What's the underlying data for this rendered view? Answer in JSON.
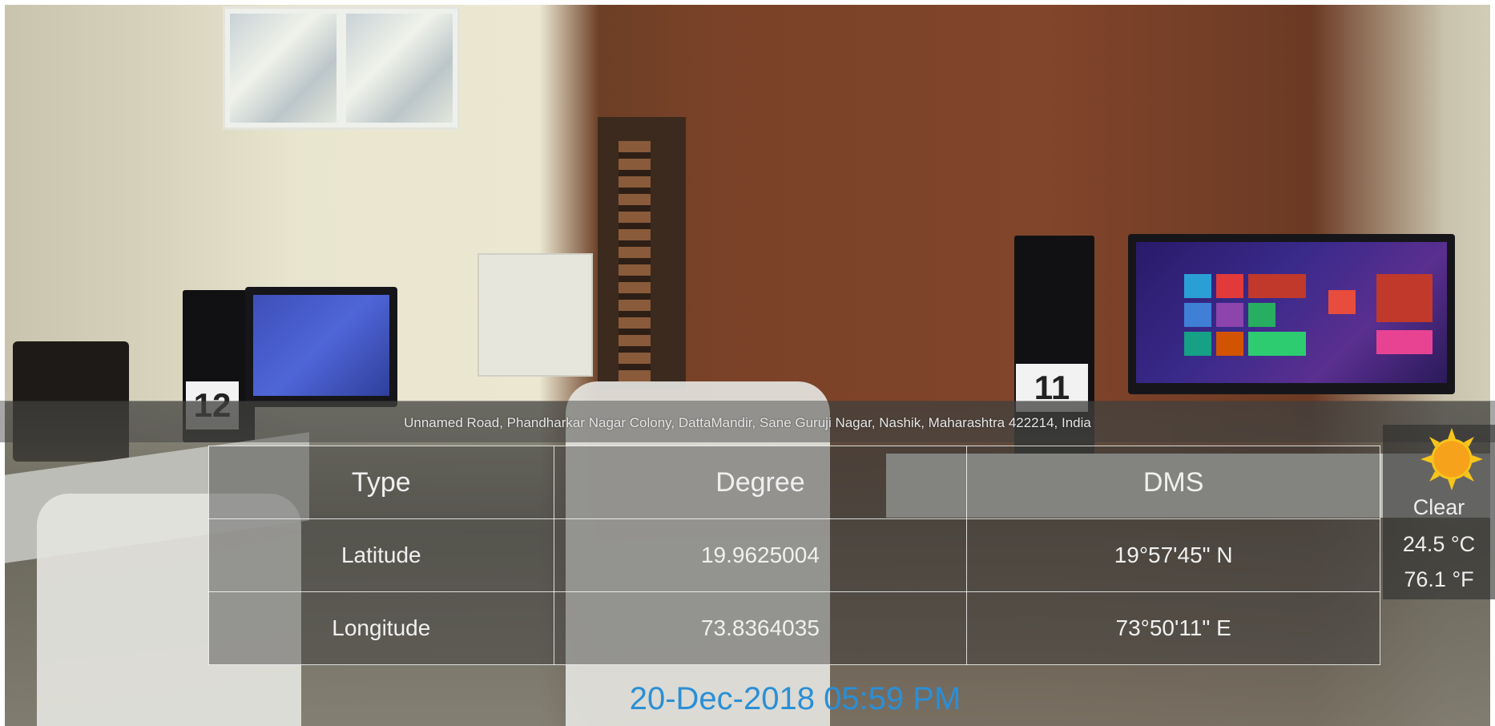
{
  "photo": {
    "monitor_tags": [
      "12",
      "11"
    ]
  },
  "overlay": {
    "address": "Unnamed Road, Phandharkar Nagar Colony, DattaMandir, Sane Guruji Nagar, Nashik, Maharashtra 422214, India",
    "table": {
      "headers": [
        "Type",
        "Degree",
        "DMS"
      ],
      "rows": [
        {
          "type": "Latitude",
          "degree": "19.9625004",
          "dms": "19°57'45\" N"
        },
        {
          "type": "Longitude",
          "degree": "73.8364035",
          "dms": "73°50'11\" E"
        }
      ]
    },
    "weather": {
      "condition": "Clear",
      "temp_c": "24.5 °C",
      "temp_f": "76.1 °F",
      "icon": "sun-icon",
      "icon_color": "#f7a21b"
    },
    "datetime": "20-Dec-2018 05:59 PM",
    "datetime_color": "#2a8fd6"
  }
}
